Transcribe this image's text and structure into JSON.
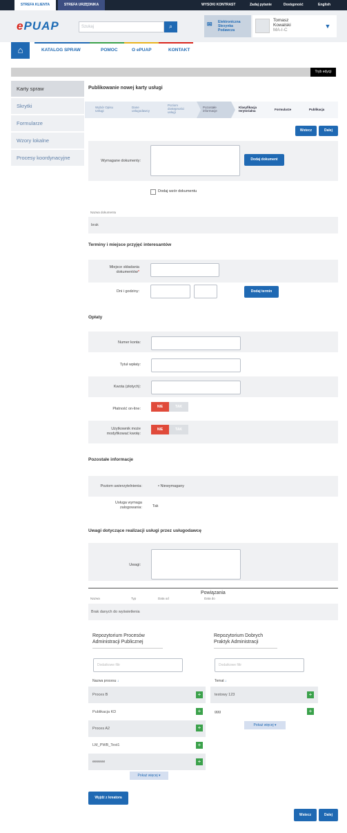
{
  "top": {
    "tab1": "STREFA KLIENTA",
    "tab2": "STREFA URZĘDNIKA",
    "links": [
      "WYSOKI KONTRAST",
      "Zadaj pytanie",
      "Dostępność",
      "English"
    ]
  },
  "header": {
    "logo_e": "e",
    "logo_rest": "PUAP",
    "search_placeholder": "Szukaj",
    "esb": [
      "Elektroniczna",
      "Skrzynka",
      "Podawcza"
    ],
    "user": [
      "Tomasz",
      "Kowalski",
      "MA-I-C"
    ]
  },
  "nav": [
    "KATALOG SPRAW",
    "POMOC",
    "O ePUAP",
    "KONTAKT"
  ],
  "edit_mode": "Tryb edycji",
  "sidebar": [
    "Karty spraw",
    "Skrytki",
    "Formularze",
    "Wzory lokalne",
    "Procesy koordynacyjne"
  ],
  "page_title": "Publikowanie nowej karty usługi",
  "steps": [
    [
      "Wybór Opisu",
      "Usługi"
    ],
    [
      "Dane",
      "usługodawcy"
    ],
    [
      "Poziom",
      "dostępności",
      "usługi"
    ],
    [
      "Pozostałe",
      "informacje"
    ],
    [
      "Klasyfikacja",
      "terytorialna"
    ],
    [
      "Formularze"
    ],
    [
      "Publikacja"
    ]
  ],
  "buttons": {
    "back": "Wstecz",
    "next": "Dalej",
    "add_doc": "Dodaj dokument",
    "add_term": "Dodaj termin",
    "exit": "Wyjdź z kreatora"
  },
  "docs": {
    "label": "Wymagane dokumenty:",
    "add_template": "Dodaj wzór dokumentu",
    "name_header": "Nazwa dokumentu",
    "name_value": "brak"
  },
  "terms": {
    "title": "Terminy i miejsce przyjęć interesantów",
    "place_label": [
      "Miejsce składania",
      "dokumentów"
    ],
    "days_label": "Dni i godziny:"
  },
  "fees": {
    "title": "Opłaty",
    "account": "Numer konta:",
    "transfer": "Tytuł wpłaty:",
    "amount": "Kwota (złotych):",
    "online": "Płatność on-line:",
    "modify": [
      "Użytkownik może",
      "modyfikować kwotę:"
    ],
    "no": "NIE",
    "yes": "TAK"
  },
  "other": {
    "title": "Pozostałe informacje",
    "auth_label": "Poziom uwierzytelnienia:",
    "auth_value": "Niewymagany",
    "login_label": [
      "Usługa wymaga",
      "zalogowania:"
    ],
    "login_value": "Tak"
  },
  "remarks": {
    "title": "Uwagi dotyczące realizacji usługi przez usługodawcę",
    "label": "Uwagi:"
  },
  "relations": {
    "title": "Powiązania",
    "cols": [
      "Nazwa",
      "Typ",
      "Data od",
      "Data do"
    ],
    "empty": "Brak danych do wyświetlenia"
  },
  "repo1": {
    "title": [
      "Repozytorium Procesów",
      "Administracji Publicznej"
    ],
    "filter": "Dodatkowe filtr",
    "col": "Nazwa procesu",
    "rows": [
      "Proces B",
      "Publikacja KD",
      "Proces A2",
      "LM_PWB_Test1",
      "eeeeee"
    ],
    "more": "Pokaż więcej"
  },
  "repo2": {
    "title": [
      "Repozytorium Dobrych",
      "Praktyk Administracji"
    ],
    "filter": "Dodatkowe filtr",
    "col": "Temat",
    "rows": [
      "testowy 123",
      "ggg"
    ],
    "more": "Pokaż więcej"
  }
}
